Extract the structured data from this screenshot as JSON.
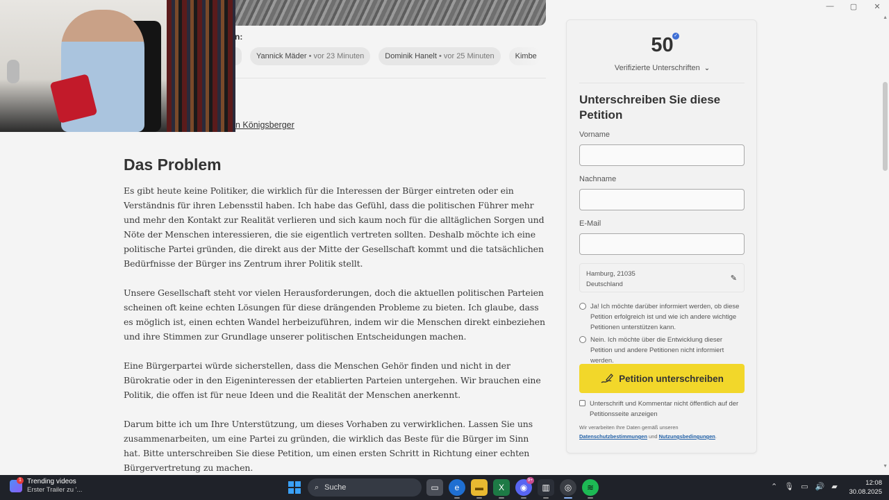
{
  "window_controls": {
    "minimize": "—",
    "maximize": "▢",
    "close": "✕"
  },
  "supporters": {
    "label": "n:",
    "chips": [
      {
        "name": "",
        "time": ""
      },
      {
        "name": "Yannick Mäder",
        "time": " • vor 23 Minuten"
      },
      {
        "name": "Dominik Hanelt",
        "time": " • vor 25 Minuten"
      },
      {
        "name": "Kimbe",
        "time": ""
      }
    ]
  },
  "author_link": "n Königsberger",
  "article": {
    "heading": "Das Problem",
    "paragraphs": [
      "Es gibt heute keine Politiker, die wirklich für die Interessen der Bürger eintreten oder ein Verständnis für ihren Lebensstil haben. Ich habe das Gefühl, dass die politischen Führer mehr und mehr den Kontakt zur Realität verlieren und sich kaum noch für die alltäglichen Sorgen und Nöte der Menschen interessieren, die sie eigentlich vertreten sollten. Deshalb möchte ich eine politische Partei gründen, die direkt aus der Mitte der Gesellschaft kommt und die tatsächlichen Bedürfnisse der Bürger ins Zentrum ihrer Politik stellt.",
      "Unsere Gesellschaft steht vor vielen Herausforderungen, doch die aktuellen politischen Parteien scheinen oft keine echten Lösungen für diese drängenden Probleme zu bieten. Ich glaube, dass es möglich ist, einen echten Wandel herbeizuführen, indem wir die Menschen direkt einbeziehen und ihre Stimmen zur Grundlage unserer politischen Entscheidungen machen.",
      "Eine Bürgerpartei würde sicherstellen, dass die Menschen Gehör finden und nicht in der Bürokratie oder in den Eigeninteressen der etablierten Parteien untergehen. Wir brauchen eine Politik, die offen ist für neue Ideen und die Realität der Menschen anerkennt.",
      "Darum bitte ich um Ihre Unterstützung, um dieses Vorhaben zu verwirklichen. Lassen Sie uns zusammenarbeiten, um eine Partei zu gründen, die wirklich das Beste für die Bürger im Sinn hat. Bitte unterschreiben Sie diese Petition, um einen ersten Schritt in Richtung einer echten Bürgervertretung zu machen."
    ]
  },
  "sign_card": {
    "count": "50",
    "verified_label": "Verifizierte Unterschriften",
    "title": "Unterschreiben Sie diese Petition",
    "first_name_label": "Vorname",
    "first_name_value": "",
    "last_name_label": "Nachname",
    "last_name_value": "",
    "email_label": "E-Mail",
    "email_value": "",
    "location_city": "Hamburg, 21035",
    "location_country": "Deutschland",
    "option_yes": "Ja! Ich möchte darüber informiert werden, ob diese Petition erfolgreich ist und wie ich andere wichtige Petitionen unterstützen kann.",
    "option_no": "Nein. Ich möchte über die Entwicklung dieser Petition und andere Petitionen nicht informiert werden.",
    "sign_button": "Petition unterschreiben",
    "hide_signature": "Unterschrift und Kommentar nicht öffentlich auf der Petitionsseite anzeigen",
    "legal_prefix": "Wir verarbeiten Ihre Daten gemäß unseren",
    "privacy_link": "Datenschutzbestimmungen",
    "legal_and": " und ",
    "terms_link": "Nutzungsbedingungen",
    "legal_suffix": "."
  },
  "taskbar": {
    "news_title": "Trending videos",
    "news_subtitle": "Erster Trailer zu '...",
    "news_badge": "1",
    "search_label": "Suche",
    "discord_badge": "9+",
    "time": "12:08",
    "date": "30.08.2025"
  },
  "colors": {
    "sign_button": "#f2d72a",
    "verified_badge": "#3f6fd6",
    "link": "#1f5fa6",
    "taskbar": "#1f2229"
  }
}
